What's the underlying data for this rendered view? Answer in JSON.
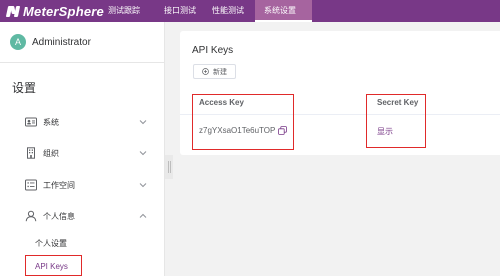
{
  "header": {
    "logo_text": "MeterSphere",
    "nav": [
      "测试跟踪",
      "接口测试",
      "性能测试",
      "系统设置"
    ],
    "active_nav": "系统设置",
    "brand_color": "#783887"
  },
  "sidebar": {
    "user": {
      "initial": "A",
      "name": "Administrator"
    },
    "title": "设置",
    "menu": [
      {
        "label": "系统",
        "icon": "id-card-icon"
      },
      {
        "label": "组织",
        "icon": "building-icon"
      },
      {
        "label": "工作空间",
        "icon": "list-icon"
      },
      {
        "label": "个人信息",
        "icon": "user-icon",
        "expanded": true
      }
    ],
    "sub_items": [
      "个人设置",
      "API Keys"
    ],
    "active_sub": "API Keys"
  },
  "main": {
    "title": "API Keys",
    "new_button": "新建",
    "columns": [
      "Access Key",
      "Secret Key"
    ],
    "rows": [
      {
        "access_key": "z7gYXsaO1Te6uTOP",
        "secret_action": "显示"
      }
    ]
  }
}
